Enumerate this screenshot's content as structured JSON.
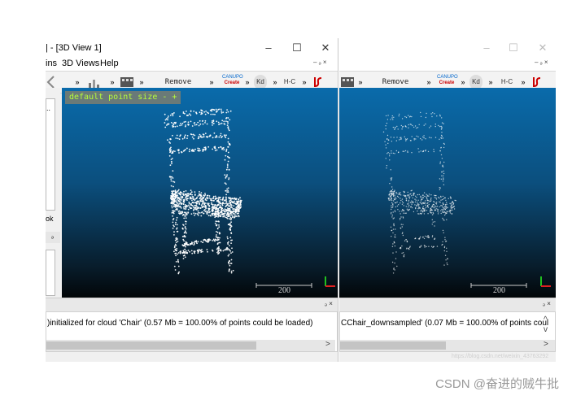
{
  "left_window": {
    "title": "| - [3D View 1]",
    "window_buttons": [
      "–",
      "☐",
      "✕"
    ],
    "menu": [
      "ins",
      "3D Views",
      "Help"
    ],
    "menu_corner": "– ₔ ×",
    "toolbar_more": "»",
    "toolbar_remove_filter": "Remove filter",
    "toolbar_canupo_top": "CANUPO",
    "toolbar_canupo_bottom": "Create",
    "toolbar_kd": "Kd",
    "toolbar_hc": "H-C",
    "viewport_label": "default point size - +",
    "scale_value": "200",
    "console_log": ")initialized for cloud 'Chair' (0.57 Mb = 100.00% of points could be loaded)",
    "console_buttons": "ₔ ×",
    "left_panel_text_1": "..",
    "left_panel_text_2": "ok",
    "left_panel_btn": "ₔ",
    "scroll_up": "^",
    "scroll_down": "v",
    "scroll_right": ">"
  },
  "right_window": {
    "window_buttons": [
      "–",
      "☐",
      "✕"
    ],
    "menu_corner": "– ₔ ×",
    "toolbar_more": "»",
    "toolbar_remove_filter": "Remove filter",
    "toolbar_canupo_top": "CANUPO",
    "toolbar_canupo_bottom": "Create",
    "toolbar_kd": "Kd",
    "toolbar_hc": "H-C",
    "scale_value": "200",
    "console_log": "CChair_downsampled' (0.07 Mb = 100.00% of points coul",
    "console_buttons": "ₔ ×",
    "scroll_up": "^",
    "scroll_down": "v",
    "scroll_right": ">",
    "faint_url": "https://blog.csdn.net/weixin_43763292"
  },
  "watermark": "CSDN @奋进的贼牛批",
  "colors": {
    "viewport_top": "#0a6bab",
    "viewport_bottom": "#020608",
    "label_text": "#b6ff3a",
    "axis_x": "#e02020",
    "axis_y": "#20c020"
  },
  "icons": [
    "back-arrow-icon",
    "filter-icon",
    "film-icon",
    "canupo-icon",
    "kd-tree-icon",
    "hc-icon",
    "segment-icon",
    "axes-icon"
  ]
}
